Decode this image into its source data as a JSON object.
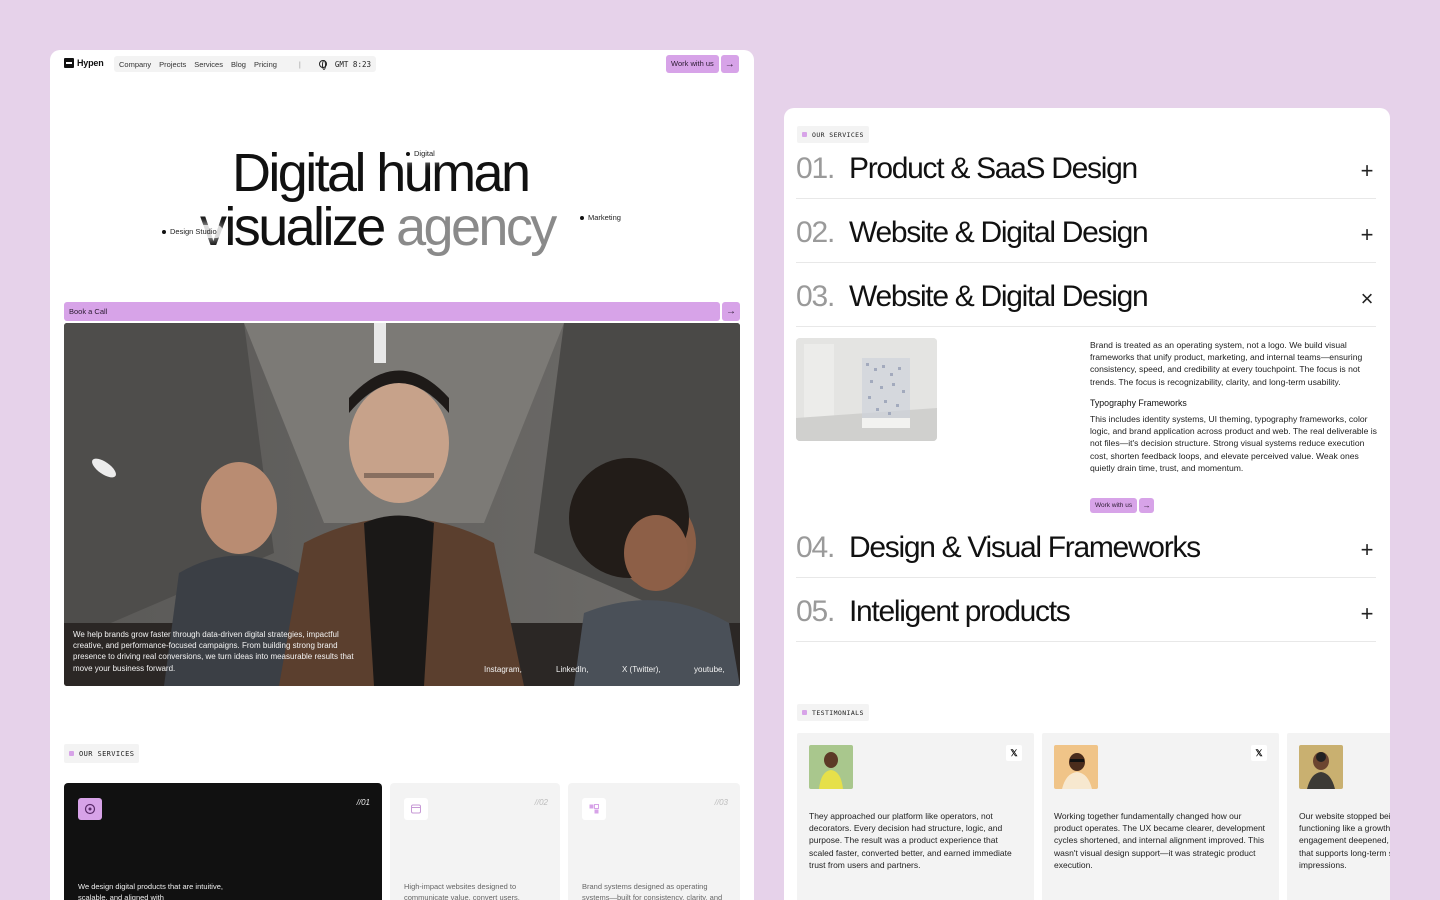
{
  "brand": {
    "name": "Hypen",
    "accent": "#d7a3e8",
    "background": "#e6d2ea"
  },
  "nav": {
    "links": [
      "Company",
      "Projects",
      "Services",
      "Blog",
      "Pricing"
    ],
    "separator": "|",
    "time": "GMT 8:23",
    "cta_label": "Work with us"
  },
  "hero": {
    "line1": "Digital human",
    "line2_dark": "visualize",
    "line2_grey": "agency",
    "tags": [
      "Digital",
      "Design Studio",
      "Marketing"
    ],
    "book_label": "Book a Call",
    "caption": "We help brands grow faster through data-driven digital strategies, impactful creative, and performance-focused campaigns. From building strong brand presence to driving real conversions, we turn ideas into measurable results that move your business forward.",
    "socials": [
      "Instagram,",
      "LinkedIn,",
      "X (Twitter),",
      "youtube,"
    ]
  },
  "services_section": {
    "chip": "OUR SERVICES",
    "cards": [
      {
        "num": "//01",
        "desc": "We design digital products that are intuitive, scalable, and aligned with",
        "icon": "design-icon"
      },
      {
        "num": "//02",
        "desc": "High-impact websites designed to communicate value, convert users,",
        "icon": "window-icon"
      },
      {
        "num": "//03",
        "desc": "Brand systems designed as operating systems—built for consistency, clarity, and",
        "icon": "grid-icon"
      }
    ]
  },
  "accordion": {
    "chip": "OUR SERVICES",
    "items": [
      {
        "idx": "01.",
        "title": "Product & SaaS Design",
        "toggle": "+"
      },
      {
        "idx": "02.",
        "title": "Website & Digital Design",
        "toggle": "+"
      },
      {
        "idx": "03.",
        "title": "Website & Digital Design",
        "toggle": "×"
      },
      {
        "idx": "04.",
        "title": "Design & Visual Frameworks",
        "toggle": "+"
      },
      {
        "idx": "05.",
        "title": "Inteligent products",
        "toggle": "+"
      }
    ],
    "expanded": {
      "body": "Brand is treated as an operating system, not a logo. We build visual frameworks that unify product, marketing, and internal teams—ensuring consistency, speed, and credibility at every touchpoint. The focus is not trends. The focus is recognizability, clarity, and long-term usability.",
      "subheading": "Typography Frameworks",
      "body2": "This includes identity systems, UI theming, typography frameworks, color logic, and brand application across product and web. The real deliverable is not files—it's decision structure. Strong visual systems reduce execution cost, shorten feedback loops, and elevate perceived value. Weak ones quietly drain time, trust, and momentum.",
      "cta_label": "Work with us"
    }
  },
  "testimonials": {
    "chip": "TESTIMONIALS",
    "items": [
      {
        "x": "𝕏",
        "quote": "They approached our platform like operators, not decorators. Every decision had structure, logic, and purpose. The result was a product experience that scaled faster, converted better, and earned immediate trust from users and partners."
      },
      {
        "x": "𝕏",
        "quote": "Working together fundamentally changed how our product operates. The UX became clearer, development cycles shortened, and internal alignment improved. This wasn't visual design support—it was strategic product execution."
      },
      {
        "x": "",
        "quote": "Our website stopped being a brochure and started functioning like a growth engine. Conversions improved, engagement deepened, and we finally had a platform that supports long-term strategy, not just surface-level impressions."
      }
    ]
  },
  "icons": {
    "arrow": "→"
  }
}
